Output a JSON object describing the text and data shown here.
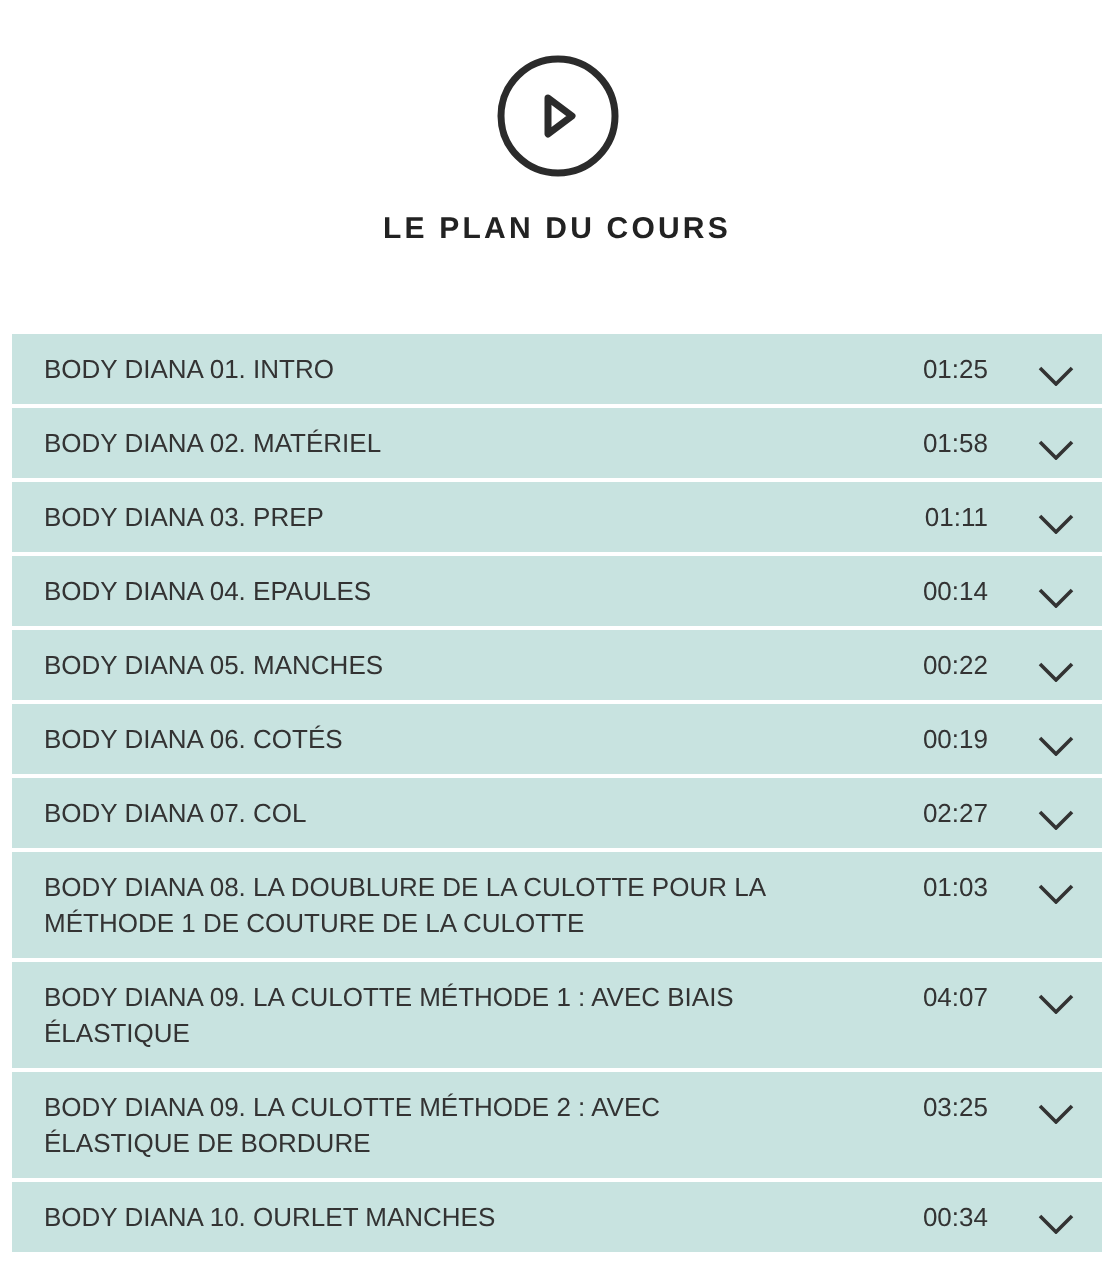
{
  "header": {
    "title": "LE PLAN DU COURS"
  },
  "lessons": [
    {
      "title": "BODY DIANA 01. INTRO",
      "duration": "01:25",
      "expanded": false
    },
    {
      "title": "BODY DIANA 02. MATÉRIEL",
      "duration": "01:58",
      "expanded": false
    },
    {
      "title": "BODY DIANA 03. PREP",
      "duration": "01:11",
      "expanded": false
    },
    {
      "title": "BODY DIANA 04. EPAULES",
      "duration": "00:14",
      "expanded": false
    },
    {
      "title": "BODY DIANA 05. MANCHES",
      "duration": "00:22",
      "expanded": false
    },
    {
      "title": "BODY DIANA 06. COTÉS",
      "duration": "00:19",
      "expanded": false
    },
    {
      "title": "BODY DIANA 07. COL",
      "duration": "02:27",
      "expanded": false
    },
    {
      "title": "BODY DIANA 08. LA DOUBLURE DE LA CULOTTE POUR LA MÉTHODE 1 DE COUTURE DE LA CULOTTE",
      "duration": "01:03",
      "expanded": false
    },
    {
      "title": "BODY DIANA 09. LA CULOTTE MÉTHODE 1 : AVEC BIAIS ÉLASTIQUE",
      "duration": "04:07",
      "expanded": false
    },
    {
      "title": "BODY DIANA 09. LA CULOTTE MÉTHODE 2 : AVEC ÉLASTIQUE DE BORDURE",
      "duration": "03:25",
      "expanded": false
    },
    {
      "title": "BODY DIANA 10. OURLET MANCHES",
      "duration": "00:34",
      "expanded": false
    }
  ]
}
